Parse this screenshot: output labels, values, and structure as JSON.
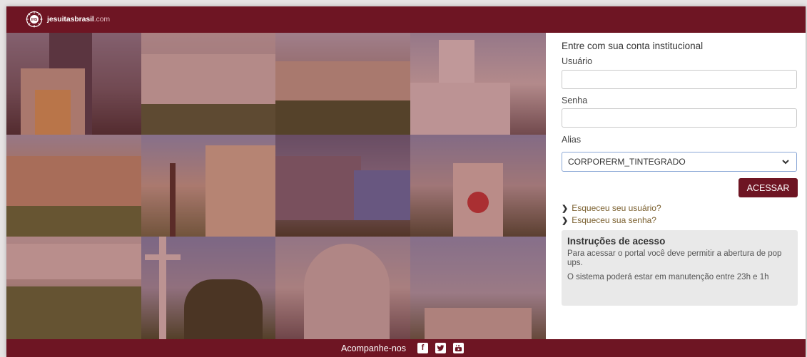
{
  "header": {
    "logo_brand": "jesuitasbrasil",
    "logo_suffix": ".com"
  },
  "login": {
    "title": "Entre com sua conta institucional",
    "username_label": "Usuário",
    "username_value": "",
    "password_label": "Senha",
    "password_value": "",
    "alias_label": "Alias",
    "alias_selected": "CORPORERM_TINTEGRADO",
    "submit_label": "ACESSAR",
    "forgot_user": "Esqueceu seu usuário?",
    "forgot_password": "Esqueceu sua senha?"
  },
  "instructions": {
    "title": "Instruções de acesso",
    "line1": "Para acessar o portal você deve permitir a abertura de pop ups.",
    "line2": "O sistema poderá estar em manutenção entre 23h e 1h"
  },
  "footer": {
    "follow_label": "Acompanhe-nos",
    "social": [
      "facebook-icon",
      "twitter-icon",
      "youtube-icon"
    ]
  },
  "colors": {
    "brand": "#6e1523",
    "link": "#7a5f2e",
    "info_bg": "#e9e9e9"
  }
}
